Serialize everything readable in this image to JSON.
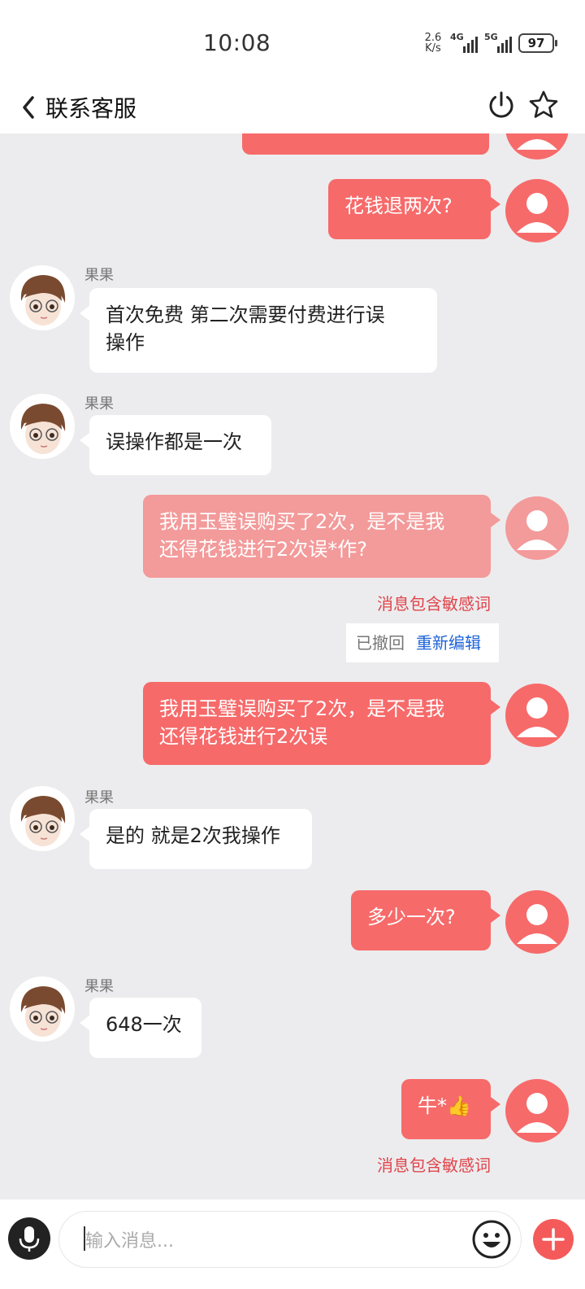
{
  "status_bar": {
    "time": "10:08",
    "net_speed_value": "2.6",
    "net_speed_unit": "K/s",
    "signal1_label": "4G",
    "signal2_label": "5G",
    "battery": "97"
  },
  "header": {
    "title": "联系客服",
    "icons": [
      "back-chevron-icon",
      "power-icon",
      "star-icon"
    ]
  },
  "chat": {
    "agent_name": "果果",
    "messages": [
      {
        "from": "me",
        "text": "花钱退两次?"
      },
      {
        "from": "agent",
        "sender": "果果",
        "text_line1": "首次免费 第二次需要付费进行误",
        "text_line2": "操作"
      },
      {
        "from": "agent",
        "sender": "果果",
        "text": "误操作都是一次"
      },
      {
        "from": "me",
        "status": "blocked",
        "text_line1": "我用玉璧误购买了2次，是不是我",
        "text_line2": "还得花钱进行2次误*作?",
        "warning": "消息包含敏感词"
      },
      {
        "from": "system",
        "recalled": "已撤回",
        "reedit": "重新编辑"
      },
      {
        "from": "me",
        "text_line1": "我用玉璧误购买了2次，是不是我",
        "text_line2": "还得花钱进行2次误"
      },
      {
        "from": "agent",
        "sender": "果果",
        "text": "是的 就是2次我操作"
      },
      {
        "from": "me",
        "text": "多少一次?"
      },
      {
        "from": "agent",
        "sender": "果果",
        "text": "648一次"
      },
      {
        "from": "me",
        "text": "牛*",
        "emoji": "👍",
        "warning": "消息包含敏感词"
      }
    ]
  },
  "input_bar": {
    "placeholder": "输入消息..."
  },
  "colors": {
    "outgoing_bubble": "#f76a6a",
    "outgoing_bubble_blocked": "#f39a9a",
    "warning_text": "#e0444a",
    "link": "#1e64d8",
    "background": "#ececee"
  }
}
